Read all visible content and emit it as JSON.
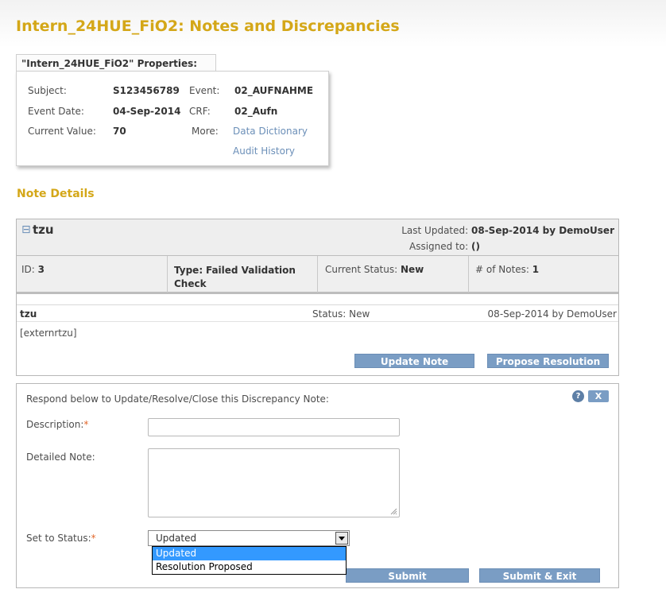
{
  "page": {
    "title": "Intern_24HUE_FiO2: Notes and Discrepancies"
  },
  "properties": {
    "tab_label": "\"Intern_24HUE_FiO2\" Properties:",
    "subject_label": "Subject:",
    "subject_value": "S123456789",
    "event_label": "Event:",
    "event_value": "02_AUFNAHME",
    "event_date_label": "Event Date:",
    "event_date_value": "04-Sep-2014",
    "crf_label": "CRF:",
    "crf_value": "02_Aufn",
    "current_value_label": "Current Value:",
    "current_value_value": "70",
    "more_label": "More:",
    "data_dictionary_link": "Data Dictionary",
    "audit_history_link": "Audit History"
  },
  "note_details": {
    "heading": "Note Details",
    "collapse_glyph": "⊟",
    "title": "tzu",
    "last_updated_label": "Last Updated:",
    "last_updated_value": "08-Sep-2014 by DemoUser",
    "assigned_label": "Assigned to:",
    "assigned_value": "()",
    "id_label": "ID:",
    "id_value": "3",
    "type_label": "Type:",
    "type_value": "Failed Validation Check",
    "status_label": "Current Status:",
    "status_value": "New",
    "num_notes_label": "# of Notes:",
    "num_notes_value": "1",
    "thread": {
      "title": "tzu",
      "status": "Status: New",
      "date_by": "08-Sep-2014 by DemoUser",
      "detail": "[externrtzu]"
    },
    "update_note_button": "Update Note",
    "propose_resolution_button": "Propose Resolution"
  },
  "respond": {
    "instruction": "Respond below to Update/Resolve/Close this Discrepancy Note:",
    "help_icon": "?",
    "close_label": "X",
    "description_label": "Description:",
    "description_value": "",
    "detailed_note_label": "Detailed Note:",
    "detailed_note_value": "",
    "required_mark": "*",
    "status_label": "Set to Status:",
    "status_selected": "Updated",
    "status_options": [
      "Updated",
      "Resolution Proposed"
    ],
    "submit_button": "Submit",
    "submit_exit_button": "Submit & Exit"
  },
  "colors": {
    "title": "#d4a718",
    "button": "#7a9dc4",
    "link": "#6b8fb8",
    "required": "#e2682c",
    "dropdown_highlight": "#3399ff"
  }
}
